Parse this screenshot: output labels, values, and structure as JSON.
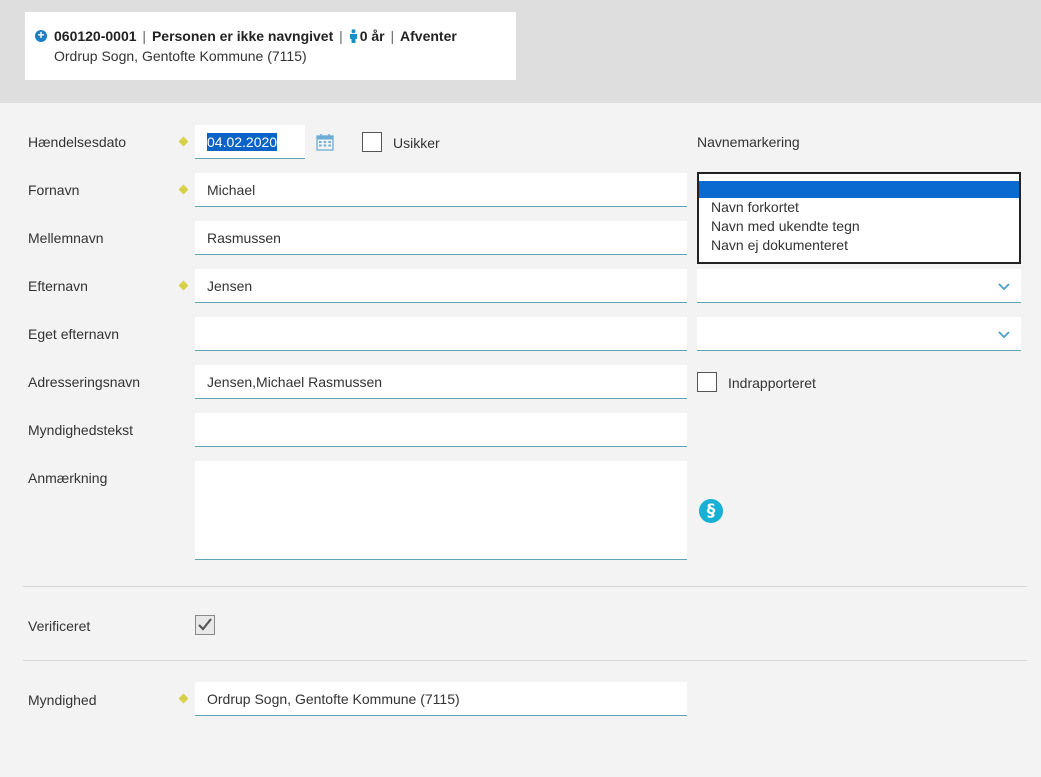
{
  "header": {
    "person_id": "060120-0001",
    "person_name": "Personen er ikke navngivet",
    "age": "0 år",
    "status": "Afventer",
    "location": "Ordrup Sogn, Gentofte Kommune (7115)",
    "separator": "|"
  },
  "form": {
    "event_date": {
      "label": "Hændelsesdato",
      "value": "04.02.2020"
    },
    "uncertain": {
      "label": "Usikker",
      "checked": false
    },
    "first_name": {
      "label": "Fornavn",
      "value": "Michael"
    },
    "middle_name": {
      "label": "Mellemnavn",
      "value": "Rasmussen"
    },
    "last_name": {
      "label": "Efternavn",
      "value": "Jensen"
    },
    "own_last_name": {
      "label": "Eget efternavn",
      "value": ""
    },
    "address_name": {
      "label": "Adresseringsnavn",
      "value": "Jensen,Michael Rasmussen"
    },
    "authority_text": {
      "label": "Myndighedstekst",
      "value": ""
    },
    "remark": {
      "label": "Anmærkning",
      "value": ""
    },
    "verified": {
      "label": "Verificeret",
      "checked": true
    },
    "authority": {
      "label": "Myndighed",
      "value": "Ordrup Sogn, Gentofte Kommune (7115)"
    }
  },
  "name_marking": {
    "label": "Navnemarkering",
    "options": [
      "",
      "Navn forkortet",
      "Navn med ukendte tegn",
      "Navn ej dokumenteret"
    ],
    "selected_index": 0
  },
  "reported": {
    "label": "Indrapporteret",
    "checked": false
  },
  "icons": {
    "add": "plus-circle-icon",
    "person": "person-icon",
    "calendar": "calendar-icon",
    "paragraph": "paragraph-icon",
    "chevron": "chevron-down-icon"
  },
  "colors": {
    "accent": "#5aa3b7",
    "selection": "#0a6ad0",
    "required": "#d9d04a",
    "paragraph_icon": "#19b0d6"
  }
}
